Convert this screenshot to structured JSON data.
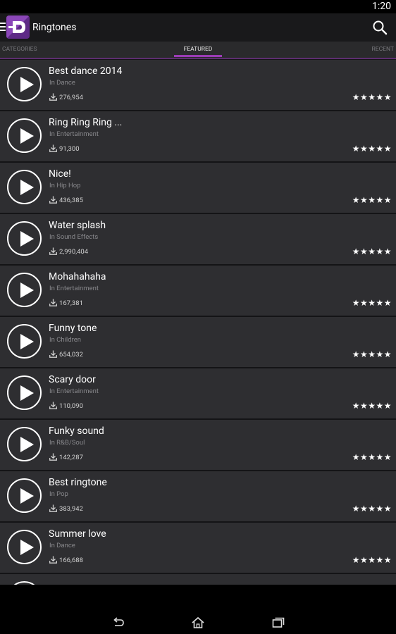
{
  "status_bar": {
    "time": "1:20"
  },
  "action_bar": {
    "title": "Ringtones"
  },
  "tabs": [
    {
      "label": "CATEGORIES"
    },
    {
      "label": "FEATURED"
    },
    {
      "label": "RECENT"
    }
  ],
  "ringtones": [
    {
      "title": "Best dance 2014",
      "category": "In Dance",
      "downloads": "276,954",
      "rating": 5
    },
    {
      "title": "Ring Ring Ring ...",
      "category": "In Entertainment",
      "downloads": "91,300",
      "rating": 5
    },
    {
      "title": "Nice!",
      "category": "In Hip Hop",
      "downloads": "436,385",
      "rating": 5
    },
    {
      "title": "Water splash",
      "category": "In Sound Effects",
      "downloads": "2,990,404",
      "rating": 5
    },
    {
      "title": "Mohahahaha",
      "category": "In Entertainment",
      "downloads": "167,381",
      "rating": 5
    },
    {
      "title": "Funny tone",
      "category": "In Children",
      "downloads": "654,032",
      "rating": 5
    },
    {
      "title": "Scary door",
      "category": "In Entertainment",
      "downloads": "110,090",
      "rating": 5
    },
    {
      "title": "Funky sound",
      "category": "In R&B/Soul",
      "downloads": "142,287",
      "rating": 5
    },
    {
      "title": "Best ringtone",
      "category": "In Pop",
      "downloads": "383,942",
      "rating": 5
    },
    {
      "title": "Summer love",
      "category": "In Dance",
      "downloads": "166,688",
      "rating": 5
    }
  ],
  "colors": {
    "accent": "#9b3cb5",
    "row_bg": "#2e2e31",
    "background": "#141416"
  },
  "icons": {
    "menu": "menu-icon",
    "search": "search-icon",
    "play": "play-icon",
    "download": "download-icon",
    "star": "star-icon",
    "back": "back-icon",
    "home": "home-icon",
    "recents": "recents-icon"
  }
}
